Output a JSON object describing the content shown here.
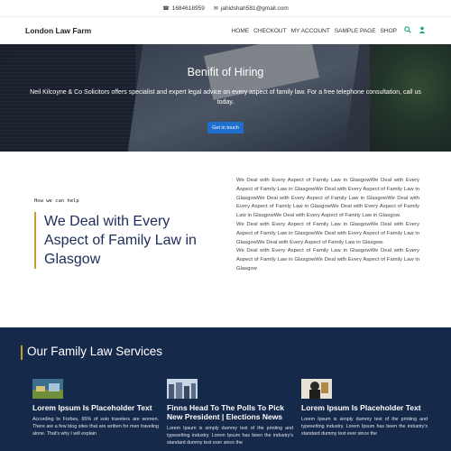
{
  "topbar": {
    "phone": "1684618959",
    "email": "jahidshah581@gmail.com",
    "phone_icon": "phone-icon",
    "email_icon": "envelope-icon"
  },
  "header": {
    "logo": "London Law Farm",
    "nav": [
      "HOME",
      "CHECKOUT",
      "MY ACCOUNT",
      "SAMPLE PAGE",
      "SHOP"
    ],
    "accent": "#17a589"
  },
  "hero": {
    "title": "Benifit of Hiring",
    "text": "Neil Kilcoyne & Co Solicitors offers specialist and expert legal advice on every aspect of family law. For a free telephone consultation, call us today.",
    "button": "Get in touch",
    "button_color": "#1f6fd1"
  },
  "about": {
    "eyebrow": "How we can help",
    "headline": "We Deal with Every Aspect of Family Law in Glasgow",
    "paragraphs": [
      "We Deal with Every Aspect of Family Law in GlasgowWe Deal with Every Aspect of Family Law in GlasgowWe Deal with Every Aspect of Family Law in GlasgowWe Deal with Every Aspect of Family Law in GlasgowWe Deal with Every Aspect of Family Law in GlasgowWe Deal with Every Aspect of Family Law in GlasgowWe Deal with Every Aspect of Family Law in Glasgow.",
      "We Deal with Every Aspect of Family Law in GlasgowWe Deal with Every Aspect of Family Law in GlasgowWe Deal with Every Aspect of Family Law in GlasgowWe Deal with Every Aspect of Family Law in Glasgow.",
      "We Deal with Every Aspect of Family Law in GlasgowWe Deal with Every Aspect of Family Law in GlasgowWe Deal with Every Aspect of Family Law in Glasgow"
    ],
    "accent": "#c99a2e",
    "headline_color": "#1c2d5a"
  },
  "services": {
    "title": "Our Family Law Services",
    "background": "#15294a",
    "cards": [
      {
        "title": "Lorem Ipsum Is Placeholder Text",
        "text": "According to Forbes, 65% of solo travelers are women. There are a few blog sites that are written for men traveling alone. That's why I will explain"
      },
      {
        "title": "Finns Head To The Polls To Pick New President | Elections News",
        "text": "Lorem Ipsum is simply dummy text of the printing and typesetting industry. Lorem Ipsum has been the industry's standard dummy text ever since the"
      },
      {
        "title": "Lorem Ipsum Is Placeholder Text",
        "text": "Lorem Ipsum is simply dummy text of the printing and typesetting industry. Lorem Ipsum has been the industry's standard dummy text ever since the"
      }
    ]
  }
}
